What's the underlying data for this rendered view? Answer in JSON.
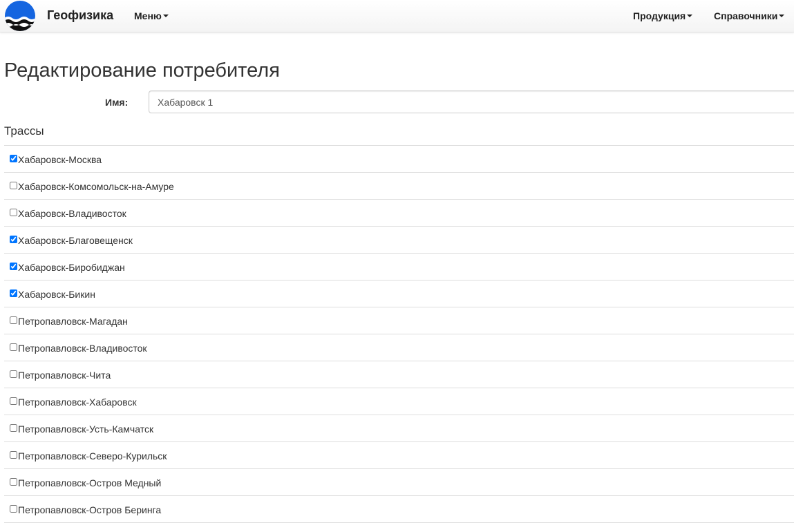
{
  "navbar": {
    "logo_icon": "wave-circle-logo-icon",
    "brand": "Геофизика",
    "menu_label": "Меню",
    "products_label": "Продукция",
    "references_label": "Справочники"
  },
  "page": {
    "title": "Редактирование потребителя"
  },
  "form": {
    "name_label": "Имя:",
    "name_value": "Хабаровск 1"
  },
  "routes": {
    "title": "Трассы",
    "items": [
      {
        "label": "Хабаровск-Москва",
        "checked": true
      },
      {
        "label": "Хабаровск-Комсомольск-на-Амуре",
        "checked": false
      },
      {
        "label": "Хабаровск-Владивосток",
        "checked": false
      },
      {
        "label": "Хабаровск-Благовещенск",
        "checked": true
      },
      {
        "label": "Хабаровск-Биробиджан",
        "checked": true
      },
      {
        "label": "Хабаровск-Бикин",
        "checked": true
      },
      {
        "label": "Петропавловск-Магадан",
        "checked": false
      },
      {
        "label": "Петропавловск-Владивосток",
        "checked": false
      },
      {
        "label": "Петропавловск-Чита",
        "checked": false
      },
      {
        "label": "Петропавловск-Хабаровск",
        "checked": false
      },
      {
        "label": "Петропавловск-Усть-Камчатск",
        "checked": false
      },
      {
        "label": "Петропавловск-Северо-Курильск",
        "checked": false
      },
      {
        "label": "Петропавловск-Остров Медный",
        "checked": false
      },
      {
        "label": "Петропавловск-Остров Беринга",
        "checked": false
      }
    ]
  },
  "colors": {
    "logo_blue": "#1565e0",
    "logo_dark": "#111111"
  }
}
